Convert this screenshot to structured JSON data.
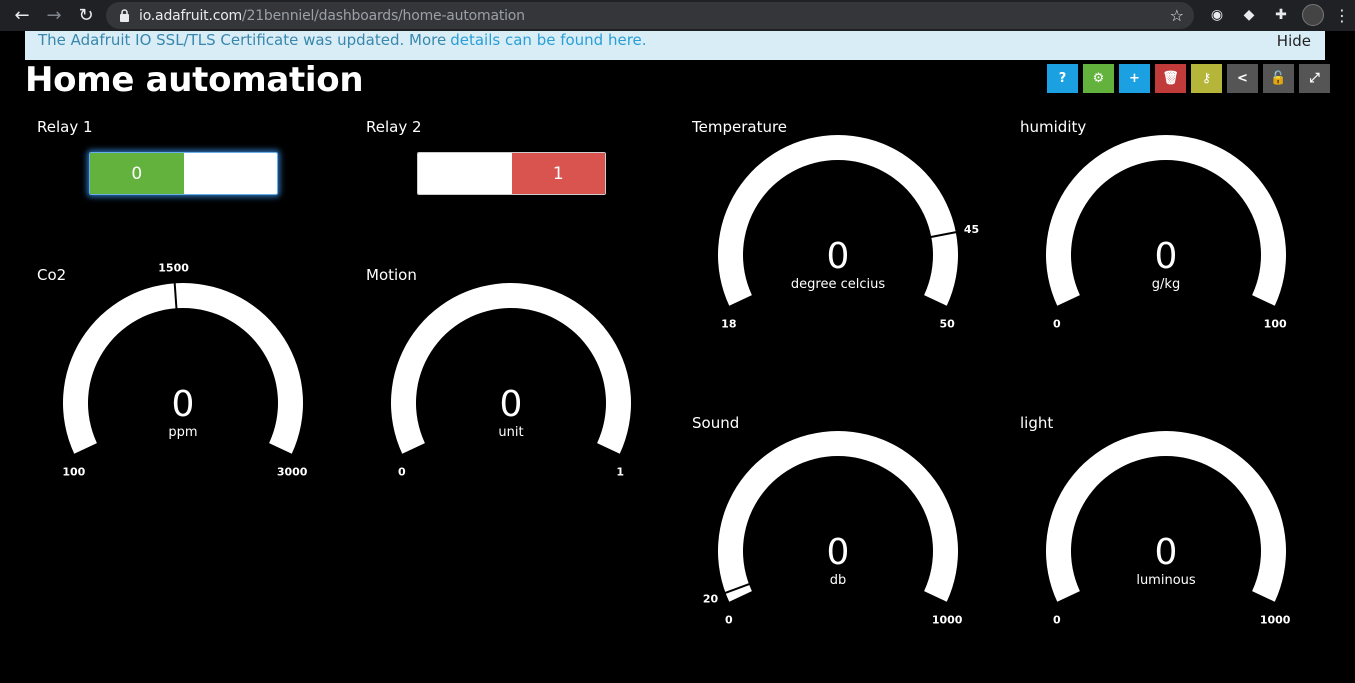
{
  "browser": {
    "url_host": "io.adafruit.com",
    "url_path": "/21benniel/dashboards/home-automation"
  },
  "notice": {
    "text": "The Adafruit IO SSL/TLS Certificate was updated. More",
    "link": "details can be found here.",
    "hide": "Hide"
  },
  "dashboard": {
    "title": "Home automation"
  },
  "toolbar": [
    {
      "name": "help-button",
      "icon": "question-icon",
      "glyph": "?",
      "color": "#1ba1e2"
    },
    {
      "name": "settings-button",
      "icon": "gear-icon",
      "glyph": "⚙",
      "color": "#62b23d"
    },
    {
      "name": "add-block-button",
      "icon": "plus-icon",
      "glyph": "+",
      "color": "#1ba1e2"
    },
    {
      "name": "delete-button",
      "icon": "trash-icon",
      "glyph": "🗑",
      "color": "#c23b3b"
    },
    {
      "name": "key-button",
      "icon": "key-icon",
      "glyph": "⚷",
      "color": "#b5b53a"
    },
    {
      "name": "share-button",
      "icon": "share-icon",
      "glyph": "<",
      "color": "#555555"
    },
    {
      "name": "lock-button",
      "icon": "unlock-icon",
      "glyph": "🔓",
      "color": "#555555"
    },
    {
      "name": "fullscreen-button",
      "icon": "expand-icon",
      "glyph": "⤢",
      "color": "#555555"
    }
  ],
  "toggles": [
    {
      "title": "Relay 1",
      "left_label": "0",
      "right_label": "",
      "active": "left",
      "active_color": "#62b23d"
    },
    {
      "title": "Relay 2",
      "left_label": "",
      "right_label": "1",
      "active": "right",
      "active_color": "#d9534f"
    }
  ],
  "gauges": [
    {
      "title": "Co2",
      "value": "0",
      "unit": "ppm",
      "min": "100",
      "max": "3000",
      "low_warning": "",
      "high_warning": "1500",
      "min_value": 100,
      "max_value": 3000,
      "high_warning_value": 1500
    },
    {
      "title": "Motion",
      "value": "0",
      "unit": "unit",
      "min": "0",
      "max": "1",
      "low_warning": "",
      "high_warning": ""
    },
    {
      "title": "Temperature",
      "value": "0",
      "unit": "degree celcius",
      "min": "18",
      "max": "50",
      "low_warning": "",
      "high_warning": "45",
      "min_value": 18,
      "max_value": 50,
      "high_warning_value": 45
    },
    {
      "title": "humidity",
      "value": "0",
      "unit": "g/kg",
      "min": "0",
      "max": "100",
      "low_warning": "",
      "high_warning": ""
    },
    {
      "title": "Sound",
      "value": "0",
      "unit": "db",
      "min": "0",
      "max": "1000",
      "low_warning": "20",
      "high_warning": "",
      "min_value": 0,
      "max_value": 1000,
      "low_warning_value": 20
    },
    {
      "title": "light",
      "value": "0",
      "unit": "luminous",
      "min": "0",
      "max": "1000",
      "low_warning": "",
      "high_warning": ""
    }
  ]
}
